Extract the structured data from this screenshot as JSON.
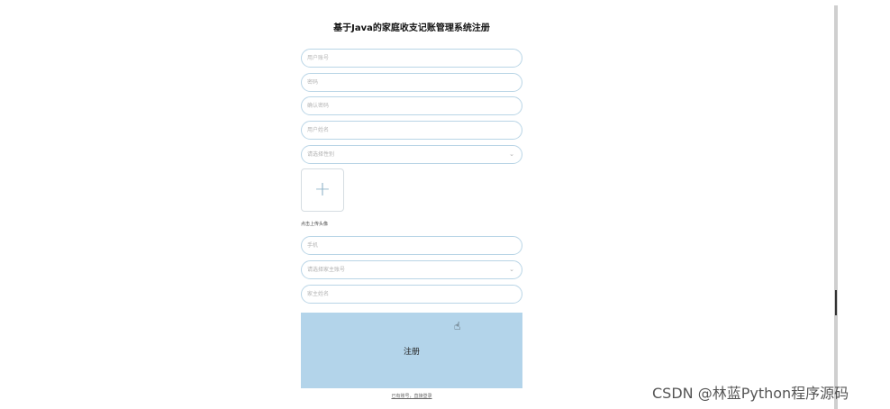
{
  "title": "基于Java的家庭收支记账管理系统注册",
  "fields": {
    "account": {
      "placeholder": "用户账号"
    },
    "password": {
      "placeholder": "密码"
    },
    "confirm_password": {
      "placeholder": "确认密码"
    },
    "name": {
      "placeholder": "用户姓名"
    },
    "gender": {
      "placeholder": "请选择性别"
    },
    "phone": {
      "placeholder": "手机"
    },
    "household_account": {
      "placeholder": "请选择家主账号"
    },
    "household_name": {
      "placeholder": "家主姓名"
    }
  },
  "upload": {
    "icon": "plus-icon",
    "label": "点击上传头像"
  },
  "submit_label": "注册",
  "login_link": "已有账号，直接登录",
  "watermark": "CSDN @林蓝Python程序源码",
  "colors": {
    "button": "#b3d4ea",
    "field_border": "#b9d5e6"
  }
}
